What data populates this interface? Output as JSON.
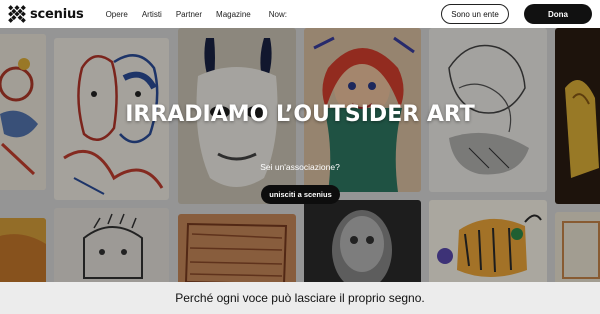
{
  "header": {
    "logo_text": "scenius",
    "nav": [
      "Opere",
      "Artisti",
      "Partner",
      "Magazine",
      "Now:"
    ],
    "btn_ente": "Sono un ente",
    "btn_dona": "Dona"
  },
  "hero": {
    "title": "IRRADIAMO L’OUTSIDER ART",
    "subtitle": "Sei un'associazione?",
    "cta": "unisciti a scenius"
  },
  "tagline": "Perché ogni voce può lasciare il proprio segno.",
  "colors": {
    "cta_bg": "#111111",
    "band_bg": "#ececec",
    "overlay": "rgba(0,0,0,0.32)"
  }
}
